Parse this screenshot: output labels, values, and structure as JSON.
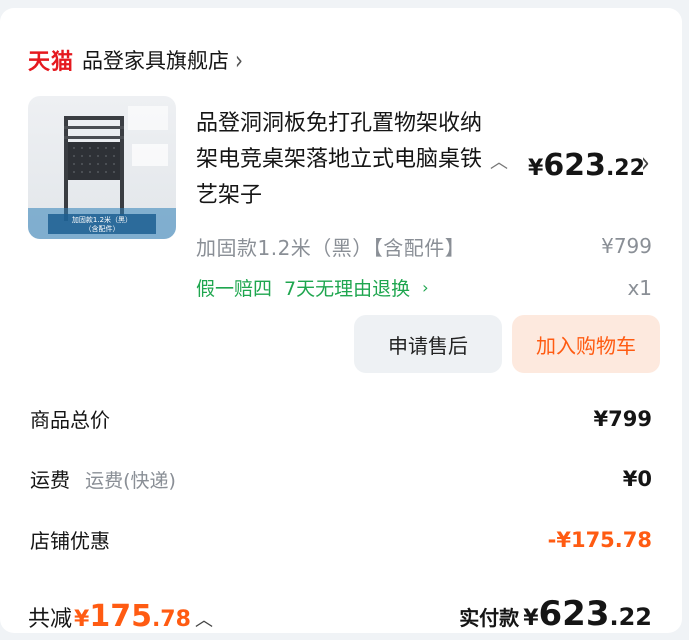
{
  "shop": {
    "platform": "天猫",
    "name": "品登家具旗舰店",
    "chevron_icon": "chevron-right-icon"
  },
  "product": {
    "title": "品登洞洞板免打孔置物架收纳架电竞桌架落地立式电脑桌铁艺架子",
    "price": {
      "currency": "¥",
      "int": "623",
      "dec": ".22"
    },
    "spec": "加固款1.2米（黑）【含配件】",
    "original_price": "¥799",
    "services": [
      "假一赔四",
      "7天无理由退换"
    ],
    "quantity": "x1",
    "thumbnail_caption": "加固款1.2米（黑）（含配件）"
  },
  "actions": {
    "after_sale": "申请售后",
    "add_to_cart": "加入购物车"
  },
  "summary": {
    "goods_total_label": "商品总价",
    "goods_total_value": "¥799",
    "shipping_label": "运费",
    "shipping_type": "运费(快递)",
    "shipping_value": "¥0",
    "discount_label": "店铺优惠",
    "discount_value": "-¥175.78"
  },
  "footer": {
    "saved_label": "共减",
    "saved_currency": "¥",
    "saved_int": "175",
    "saved_dec": ".78",
    "paid_label": "实付款",
    "paid_currency": "¥",
    "paid_int": "623",
    "paid_dec": ".22"
  },
  "colors": {
    "brand_red": "#e5191f",
    "accent_orange": "#ff5b12",
    "service_green": "#1fa64f",
    "muted_gray": "#8a8f96"
  }
}
